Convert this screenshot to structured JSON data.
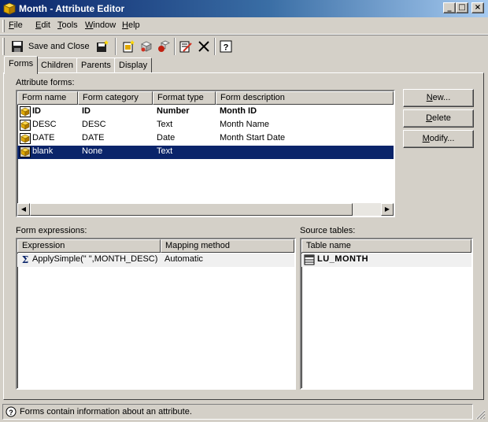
{
  "window": {
    "title": "Month - Attribute Editor",
    "minimize_label": "_",
    "maximize_label": "□",
    "close_label": "×"
  },
  "menu": [
    "File",
    "Edit",
    "Tools",
    "Window",
    "Help"
  ],
  "toolbar": {
    "save_and_close_label": "Save and Close"
  },
  "tabs": [
    "Forms",
    "Children",
    "Parents",
    "Display"
  ],
  "active_tab": "Forms",
  "attribute_forms": {
    "label": "Attribute forms:",
    "columns": [
      "Form name",
      "Form category",
      "Format type",
      "Form description"
    ],
    "rows": [
      {
        "name": "ID",
        "category": "ID",
        "format": "Number",
        "description": "Month ID",
        "bold": true,
        "selected": false
      },
      {
        "name": "DESC",
        "category": "DESC",
        "format": "Text",
        "description": "Month Name",
        "bold": false,
        "selected": false
      },
      {
        "name": "DATE",
        "category": "DATE",
        "format": "Date",
        "description": "Month Start Date",
        "bold": false,
        "selected": false
      },
      {
        "name": "blank",
        "category": "None",
        "format": "Text",
        "description": "",
        "bold": false,
        "selected": true
      }
    ]
  },
  "buttons": {
    "new": "New...",
    "delete": "Delete",
    "modify": "Modify..."
  },
  "form_expressions": {
    "label": "Form expressions:",
    "columns": [
      "Expression",
      "Mapping method"
    ],
    "rows": [
      {
        "expression": "ApplySimple(\" \",MONTH_DESC)",
        "mapping": "Automatic"
      }
    ]
  },
  "source_tables": {
    "label": "Source tables:",
    "columns": [
      "Table name"
    ],
    "rows": [
      {
        "table": "LU_MONTH"
      }
    ]
  },
  "status": {
    "text": "Forms contain information about an attribute."
  },
  "colors": {
    "selection": "#0a246a",
    "face": "#d4d0c8"
  }
}
